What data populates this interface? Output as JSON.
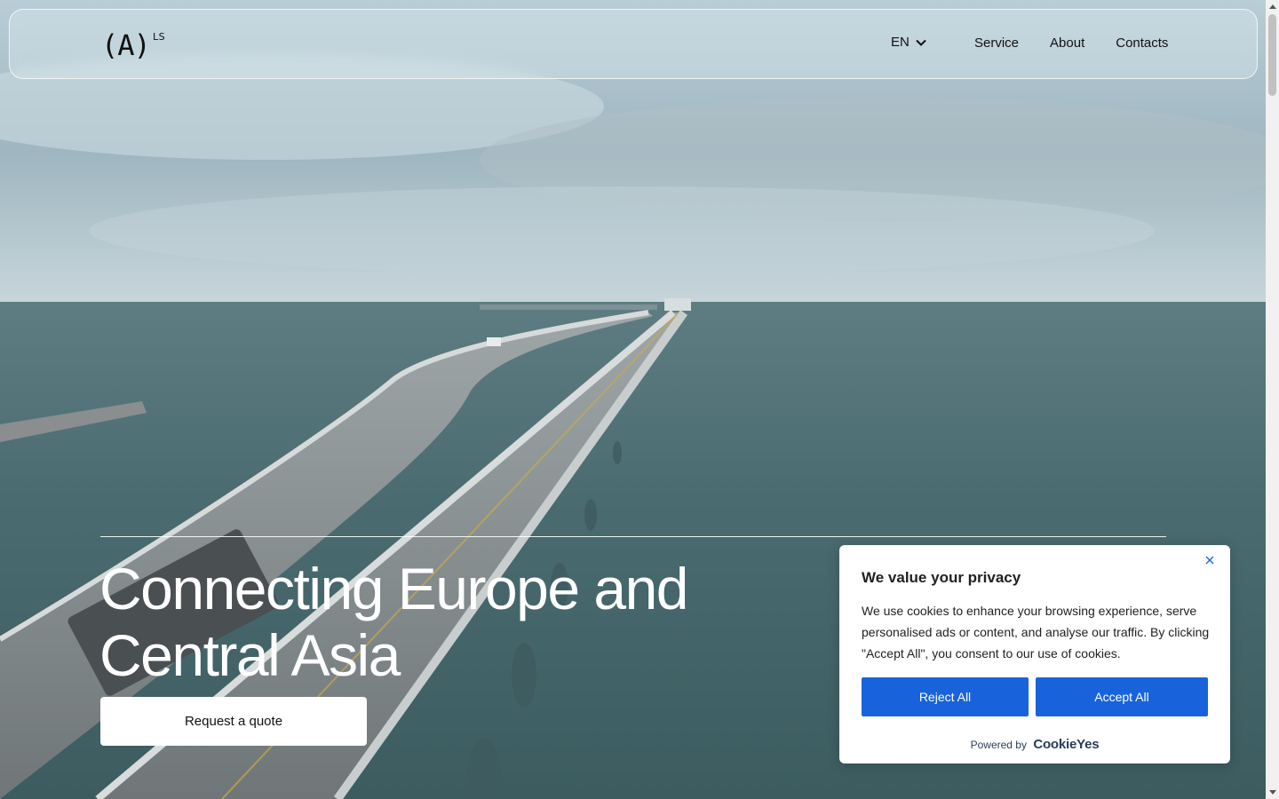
{
  "header": {
    "logo_mark": "(A)",
    "logo_sup": "LS",
    "language": "EN",
    "nav": [
      "Service",
      "About",
      "Contacts"
    ]
  },
  "hero": {
    "headline_line1": "Connecting Europe and",
    "headline_line2": "Central Asia",
    "cta_label": "Request a quote"
  },
  "cookie_banner": {
    "title": "We value your privacy",
    "body": "We use cookies to enhance your browsing experience, serve personalised ads or content, and analyse our traffic. By clicking \"Accept All\", you consent to our use of cookies.",
    "reject_label": "Reject All",
    "accept_label": "Accept All",
    "powered_by": "Powered by",
    "brand": "CookieYes",
    "accent_color": "#1863dc"
  },
  "icons": {
    "language_dropdown": "chevron-down-icon",
    "close": "close-icon"
  }
}
